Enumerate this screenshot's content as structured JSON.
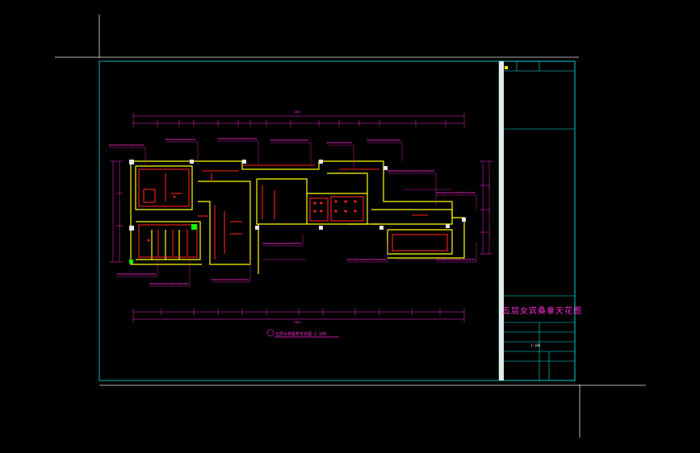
{
  "drawing": {
    "title": "五层女宾桑拿天花图",
    "view_caption": "五层女宾桑拿天花图 1:100",
    "scale_text": "1:100",
    "top_overall_dim": "4384",
    "bottom_overall_dim": "4384"
  },
  "colors": {
    "background": "#000000",
    "border": "#00e5e5",
    "wall": "#ffff00",
    "ceiling": "#ff2020",
    "annotation": "#ff2bd6",
    "white": "#e8e8e8",
    "green": "#00ff00"
  }
}
